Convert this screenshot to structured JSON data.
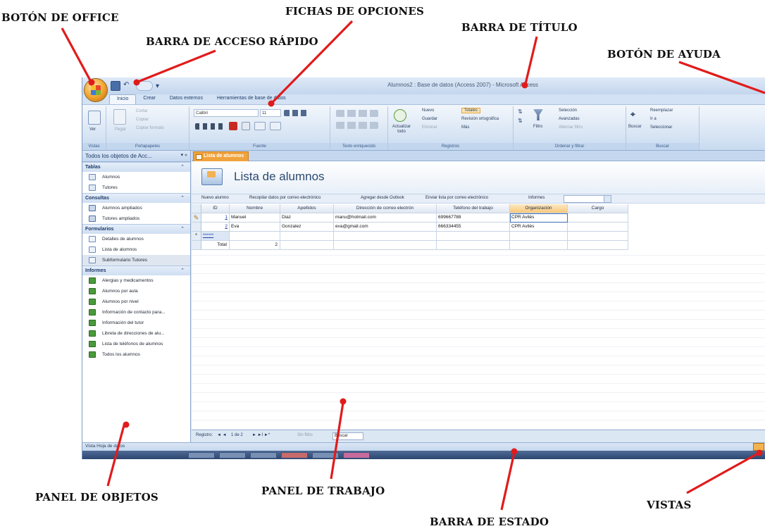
{
  "callouts": {
    "office_button": "BOTÓN DE OFFICE",
    "options_tabs": "FICHAS DE OPCIONES",
    "quick_access": "BARRA DE ACCESO RÁPIDO",
    "title_bar": "BARRA DE TÍTULO",
    "help_button": "BOTÓN DE AYUDA",
    "objects_panel": "PANEL DE OBJETOS",
    "work_panel": "PANEL DE TRABAJO",
    "views": "VISTAS",
    "status_bar": "BARRA DE ESTADO"
  },
  "window": {
    "title": "Alumnos2 : Base de datos (Access 2007) - Microsoft Access",
    "tabs": [
      "Inicio",
      "Crear",
      "Datos externos",
      "Herramientas de base de datos"
    ]
  },
  "ribbon": {
    "groups": [
      "Vistas",
      "Portapapeles",
      "Fuente",
      "Texto enriquecido",
      "Registros",
      "Ordenar y filtrar",
      "Buscar"
    ],
    "vistas": {
      "ver": "Ver"
    },
    "portapapeles": {
      "pegar": "Pegar",
      "cortar": "Cortar",
      "copiar": "Copiar",
      "copiar_formato": "Copiar formato"
    },
    "fuente": {
      "font": "Calibri",
      "size": "11"
    },
    "registros": {
      "actualizar": "Actualizar todo",
      "nuevo": "Nuevo",
      "guardar": "Guardar",
      "eliminar": "Eliminar",
      "totales": "Totales",
      "revision": "Revisión ortográfica",
      "mas": "Más"
    },
    "filtrar": {
      "filtro": "Filtro",
      "seleccion": "Selección",
      "avanzadas": "Avanzadas",
      "alternar": "Alternar filtro"
    },
    "buscar": {
      "buscar": "Buscar",
      "reemplazar": "Reemplazar",
      "ir_a": "Ir a",
      "seleccionar": "Seleccionar"
    }
  },
  "nav": {
    "header": "Todos los objetos de Acc...",
    "sections": [
      {
        "title": "Tablas",
        "items": [
          "Alumnos",
          "Tutores"
        ]
      },
      {
        "title": "Consultas",
        "items": [
          "Alumnos ampliados",
          "Tutores ampliados"
        ]
      },
      {
        "title": "Formularios",
        "items": [
          "Detalles de alumnos",
          "Lista de alumnos",
          "Subformulario Tutores"
        ]
      },
      {
        "title": "Informes",
        "items": [
          "Alergias y medicamentos",
          "Alumnos por aula",
          "Alumnos por nivel",
          "Información de contacto para...",
          "Información del tutor",
          "Libreta de direcciones de alu...",
          "Lista de teléfonos de alumnos",
          "Todos los alumnos"
        ]
      }
    ]
  },
  "doc": {
    "tab": "Lista de alumnos",
    "title": "Lista de alumnos",
    "actions": [
      "Nuevo alumno",
      "Recopilar datos por correo electrónico",
      "Agregar desde Outlook",
      "Enviar lista por correo electrónico",
      "Informes"
    ]
  },
  "grid": {
    "columns": [
      "ID",
      "Nombre",
      "Apellidos",
      "Dirección de correo electrón",
      "Teléfono del trabajo",
      "Organización",
      "Cargo"
    ],
    "rows": [
      [
        "1",
        "Manuel",
        "Diaz",
        "manu@hotmail.com",
        "699667788",
        "CPR Avilés",
        ""
      ],
      [
        "2",
        "Eva",
        "Gonzalez",
        "eva@gmail.com",
        "666334455",
        "CPR Avilés",
        ""
      ]
    ],
    "new_row_marker": "******",
    "total_label": "Total",
    "total_value": "2"
  },
  "recnav": {
    "label": "Registro:",
    "position": "1 de 2",
    "filter": "Sin filtro",
    "search": "Buscar"
  },
  "status": {
    "text": "Vista Hoja de datos"
  }
}
